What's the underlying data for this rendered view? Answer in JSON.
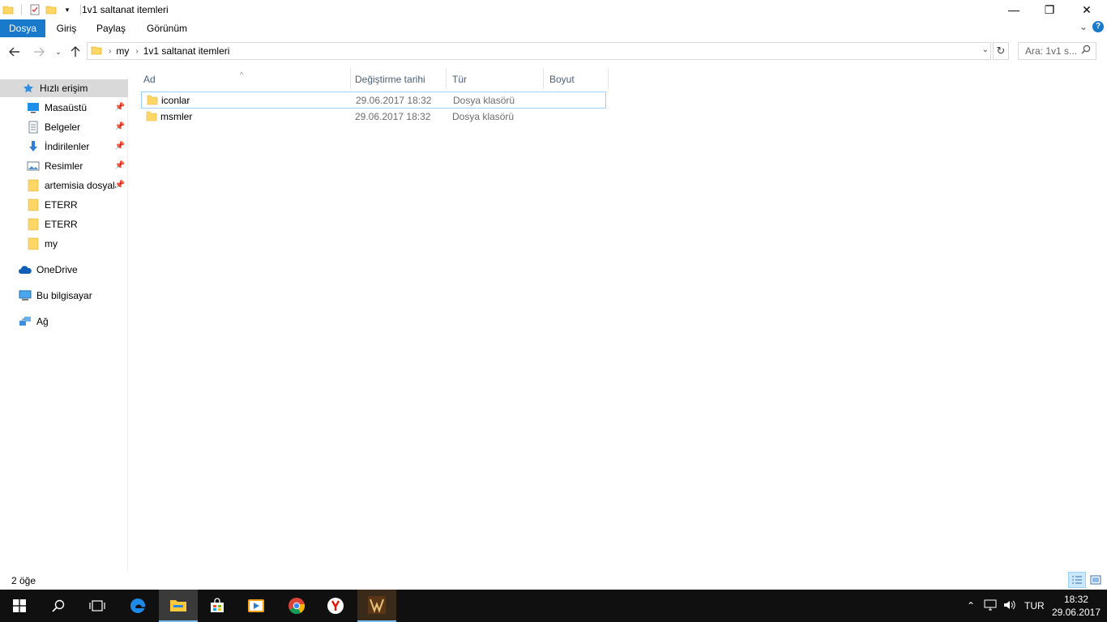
{
  "window": {
    "title": "1v1 saltanat itemleri",
    "minimize": "—",
    "restore": "❐",
    "close": "✕"
  },
  "ribbon": {
    "tabs": [
      {
        "label": "Dosya",
        "active": true
      },
      {
        "label": "Giriş"
      },
      {
        "label": "Paylaş"
      },
      {
        "label": "Görünüm"
      }
    ],
    "expand": "⌄",
    "help": "?"
  },
  "address": {
    "crumbs": [
      "my",
      "1v1 saltanat itemleri"
    ],
    "search_placeholder": "Ara: 1v1 s..."
  },
  "nav": {
    "quick_access": "Hızlı erişim",
    "items": [
      {
        "label": "Masaüstü",
        "icon": "desktop-icon",
        "pinned": true
      },
      {
        "label": "Belgeler",
        "icon": "documents-icon",
        "pinned": true
      },
      {
        "label": "İndirilenler",
        "icon": "downloads-icon",
        "pinned": true
      },
      {
        "label": "Resimler",
        "icon": "pictures-icon",
        "pinned": true
      },
      {
        "label": "artemisia dosyala",
        "icon": "folder-icon",
        "pinned": true
      },
      {
        "label": "ETERR",
        "icon": "folder-icon"
      },
      {
        "label": "ETERR",
        "icon": "folder-icon"
      },
      {
        "label": "my",
        "icon": "folder-icon"
      }
    ],
    "onedrive": "OneDrive",
    "this_pc": "Bu bilgisayar",
    "network": "Ağ"
  },
  "columns": {
    "name": "Ad",
    "modified": "Değiştirme tarihi",
    "type": "Tür",
    "size": "Boyut"
  },
  "files": [
    {
      "name": "iconlar",
      "modified": "29.06.2017 18:32",
      "type": "Dosya klasörü"
    },
    {
      "name": "msmler",
      "modified": "29.06.2017 18:32",
      "type": "Dosya klasörü"
    }
  ],
  "status": {
    "count": "2 öğe"
  },
  "taskbar": {
    "language": "TUR",
    "time": "18:32",
    "date": "29.06.2017"
  },
  "colors": {
    "accent": "#1979ca",
    "folder": "#ffd766",
    "taskbar": "#101010"
  }
}
